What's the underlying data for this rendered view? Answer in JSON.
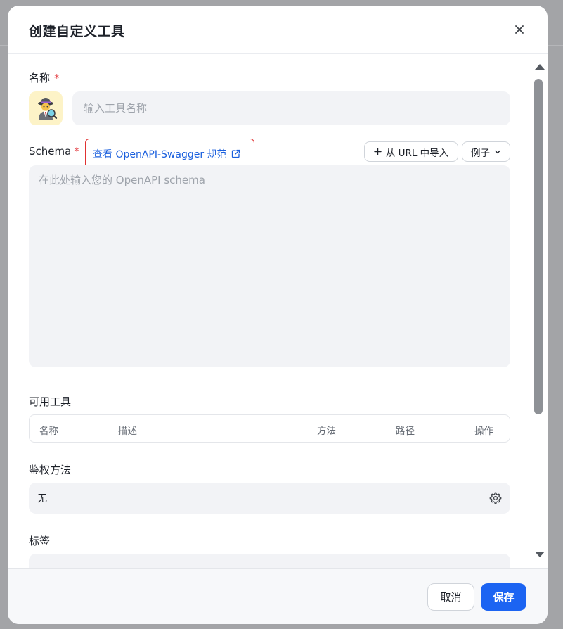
{
  "dialog": {
    "title": "创建自定义工具",
    "close_icon": "close-icon"
  },
  "form": {
    "name": {
      "label": "名称",
      "required_mark": "*",
      "placeholder": "输入工具名称",
      "value": "",
      "avatar_icon": "detective-emoji-icon"
    },
    "schema": {
      "label": "Schema",
      "required_mark": "*",
      "spec_link": "查看 OpenAPI-Swagger 规范",
      "import_url_button": "从 URL 中导入",
      "examples_button": "例子",
      "placeholder": "在此处输入您的 OpenAPI schema",
      "value": ""
    },
    "available_tools": {
      "label": "可用工具",
      "columns": [
        "名称",
        "描述",
        "方法",
        "路径",
        "操作"
      ]
    },
    "auth": {
      "label": "鉴权方法",
      "value": "无",
      "settings_icon": "gear-icon"
    },
    "tags": {
      "label": "标签"
    }
  },
  "footer": {
    "cancel_label": "取消",
    "save_label": "保存"
  },
  "colors": {
    "primary": "#1c64f2",
    "required": "#e5484d",
    "link": "#1a5fdd",
    "highlight_border": "#e03131",
    "input_bg": "#f2f3f6"
  }
}
